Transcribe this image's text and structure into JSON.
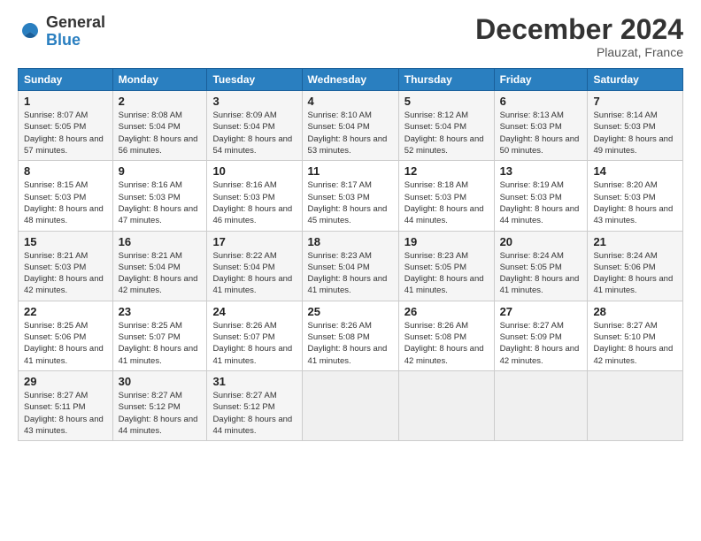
{
  "logo": {
    "line1": "General",
    "line2": "Blue"
  },
  "header": {
    "month_year": "December 2024",
    "location": "Plauzat, France"
  },
  "weekdays": [
    "Sunday",
    "Monday",
    "Tuesday",
    "Wednesday",
    "Thursday",
    "Friday",
    "Saturday"
  ],
  "weeks": [
    [
      {
        "day": "1",
        "sunrise": "Sunrise: 8:07 AM",
        "sunset": "Sunset: 5:05 PM",
        "daylight": "Daylight: 8 hours and 57 minutes."
      },
      {
        "day": "2",
        "sunrise": "Sunrise: 8:08 AM",
        "sunset": "Sunset: 5:04 PM",
        "daylight": "Daylight: 8 hours and 56 minutes."
      },
      {
        "day": "3",
        "sunrise": "Sunrise: 8:09 AM",
        "sunset": "Sunset: 5:04 PM",
        "daylight": "Daylight: 8 hours and 54 minutes."
      },
      {
        "day": "4",
        "sunrise": "Sunrise: 8:10 AM",
        "sunset": "Sunset: 5:04 PM",
        "daylight": "Daylight: 8 hours and 53 minutes."
      },
      {
        "day": "5",
        "sunrise": "Sunrise: 8:12 AM",
        "sunset": "Sunset: 5:04 PM",
        "daylight": "Daylight: 8 hours and 52 minutes."
      },
      {
        "day": "6",
        "sunrise": "Sunrise: 8:13 AM",
        "sunset": "Sunset: 5:03 PM",
        "daylight": "Daylight: 8 hours and 50 minutes."
      },
      {
        "day": "7",
        "sunrise": "Sunrise: 8:14 AM",
        "sunset": "Sunset: 5:03 PM",
        "daylight": "Daylight: 8 hours and 49 minutes."
      }
    ],
    [
      {
        "day": "8",
        "sunrise": "Sunrise: 8:15 AM",
        "sunset": "Sunset: 5:03 PM",
        "daylight": "Daylight: 8 hours and 48 minutes."
      },
      {
        "day": "9",
        "sunrise": "Sunrise: 8:16 AM",
        "sunset": "Sunset: 5:03 PM",
        "daylight": "Daylight: 8 hours and 47 minutes."
      },
      {
        "day": "10",
        "sunrise": "Sunrise: 8:16 AM",
        "sunset": "Sunset: 5:03 PM",
        "daylight": "Daylight: 8 hours and 46 minutes."
      },
      {
        "day": "11",
        "sunrise": "Sunrise: 8:17 AM",
        "sunset": "Sunset: 5:03 PM",
        "daylight": "Daylight: 8 hours and 45 minutes."
      },
      {
        "day": "12",
        "sunrise": "Sunrise: 8:18 AM",
        "sunset": "Sunset: 5:03 PM",
        "daylight": "Daylight: 8 hours and 44 minutes."
      },
      {
        "day": "13",
        "sunrise": "Sunrise: 8:19 AM",
        "sunset": "Sunset: 5:03 PM",
        "daylight": "Daylight: 8 hours and 44 minutes."
      },
      {
        "day": "14",
        "sunrise": "Sunrise: 8:20 AM",
        "sunset": "Sunset: 5:03 PM",
        "daylight": "Daylight: 8 hours and 43 minutes."
      }
    ],
    [
      {
        "day": "15",
        "sunrise": "Sunrise: 8:21 AM",
        "sunset": "Sunset: 5:03 PM",
        "daylight": "Daylight: 8 hours and 42 minutes."
      },
      {
        "day": "16",
        "sunrise": "Sunrise: 8:21 AM",
        "sunset": "Sunset: 5:04 PM",
        "daylight": "Daylight: 8 hours and 42 minutes."
      },
      {
        "day": "17",
        "sunrise": "Sunrise: 8:22 AM",
        "sunset": "Sunset: 5:04 PM",
        "daylight": "Daylight: 8 hours and 41 minutes."
      },
      {
        "day": "18",
        "sunrise": "Sunrise: 8:23 AM",
        "sunset": "Sunset: 5:04 PM",
        "daylight": "Daylight: 8 hours and 41 minutes."
      },
      {
        "day": "19",
        "sunrise": "Sunrise: 8:23 AM",
        "sunset": "Sunset: 5:05 PM",
        "daylight": "Daylight: 8 hours and 41 minutes."
      },
      {
        "day": "20",
        "sunrise": "Sunrise: 8:24 AM",
        "sunset": "Sunset: 5:05 PM",
        "daylight": "Daylight: 8 hours and 41 minutes."
      },
      {
        "day": "21",
        "sunrise": "Sunrise: 8:24 AM",
        "sunset": "Sunset: 5:06 PM",
        "daylight": "Daylight: 8 hours and 41 minutes."
      }
    ],
    [
      {
        "day": "22",
        "sunrise": "Sunrise: 8:25 AM",
        "sunset": "Sunset: 5:06 PM",
        "daylight": "Daylight: 8 hours and 41 minutes."
      },
      {
        "day": "23",
        "sunrise": "Sunrise: 8:25 AM",
        "sunset": "Sunset: 5:07 PM",
        "daylight": "Daylight: 8 hours and 41 minutes."
      },
      {
        "day": "24",
        "sunrise": "Sunrise: 8:26 AM",
        "sunset": "Sunset: 5:07 PM",
        "daylight": "Daylight: 8 hours and 41 minutes."
      },
      {
        "day": "25",
        "sunrise": "Sunrise: 8:26 AM",
        "sunset": "Sunset: 5:08 PM",
        "daylight": "Daylight: 8 hours and 41 minutes."
      },
      {
        "day": "26",
        "sunrise": "Sunrise: 8:26 AM",
        "sunset": "Sunset: 5:08 PM",
        "daylight": "Daylight: 8 hours and 42 minutes."
      },
      {
        "day": "27",
        "sunrise": "Sunrise: 8:27 AM",
        "sunset": "Sunset: 5:09 PM",
        "daylight": "Daylight: 8 hours and 42 minutes."
      },
      {
        "day": "28",
        "sunrise": "Sunrise: 8:27 AM",
        "sunset": "Sunset: 5:10 PM",
        "daylight": "Daylight: 8 hours and 42 minutes."
      }
    ],
    [
      {
        "day": "29",
        "sunrise": "Sunrise: 8:27 AM",
        "sunset": "Sunset: 5:11 PM",
        "daylight": "Daylight: 8 hours and 43 minutes."
      },
      {
        "day": "30",
        "sunrise": "Sunrise: 8:27 AM",
        "sunset": "Sunset: 5:12 PM",
        "daylight": "Daylight: 8 hours and 44 minutes."
      },
      {
        "day": "31",
        "sunrise": "Sunrise: 8:27 AM",
        "sunset": "Sunset: 5:12 PM",
        "daylight": "Daylight: 8 hours and 44 minutes."
      },
      null,
      null,
      null,
      null
    ]
  ]
}
